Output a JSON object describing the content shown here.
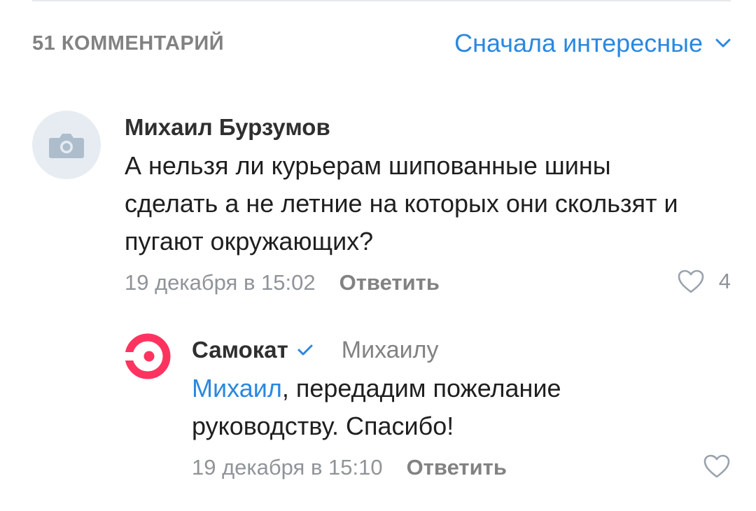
{
  "header": {
    "comments_count_label": "51 КОММЕНТАРИЙ",
    "sort_label": "Сначала интересные",
    "accent_color": "#2a88e0"
  },
  "comments": [
    {
      "author": "Михаил Бурзумов",
      "avatar_icon": "camera-icon",
      "text": "А нельзя ли курьерам шипованные шины сделать а не летние на которых они скользят и пугают окружающих?",
      "date": "19 декабря в 15:02",
      "reply_label": "Ответить",
      "likes": "4"
    },
    {
      "author": "Самокат",
      "avatar_icon": "samokat-logo",
      "verified_icon": "verified-check-icon",
      "reply_to": "Михаилу",
      "mention": "Михаил",
      "text": ", передадим пожелание руководству. Спасибо!",
      "date": "19 декабря в 15:10",
      "reply_label": "Ответить",
      "brand_color": "#ff335f"
    }
  ]
}
